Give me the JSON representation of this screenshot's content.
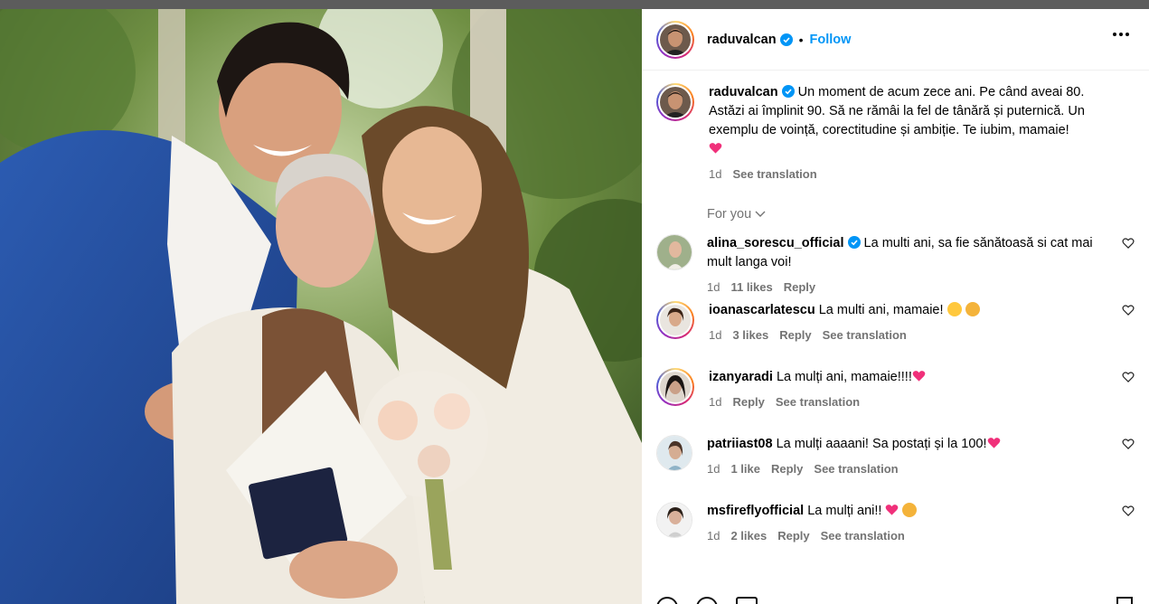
{
  "post": {
    "username": "raduvalcan",
    "follow_label": "Follow",
    "dot": "•",
    "caption": "Un moment de acum zece ani. Pe când aveai 80. Astăzi ai împlinit 90. Să ne rămâi la fel de tânără și puternică. Un exemplu de voință, corectitudine și ambiție. Te iubim, mamaie!",
    "caption_time": "1d",
    "see_translation": "See translation"
  },
  "for_you_label": "For you",
  "comments": [
    {
      "username": "alina_sorescu_official",
      "verified": true,
      "text": "La multi ani, sa fie sănătoasă si cat mai mult langa voi!",
      "time": "1d",
      "likes": "11 likes",
      "reply": "Reply",
      "translate": ""
    },
    {
      "username": "ioanascarlatescu",
      "verified": false,
      "text": "La multi ani, mamaie!",
      "time": "1d",
      "likes": "3 likes",
      "reply": "Reply",
      "translate": "See translation"
    },
    {
      "username": "izanyaradi",
      "verified": false,
      "text": "La mulți ani, mamaie!!!!",
      "time": "1d",
      "likes": "",
      "reply": "Reply",
      "translate": "See translation"
    },
    {
      "username": "patriiast08",
      "verified": false,
      "text": "La mulți aaaani! Sa postați și la 100!",
      "time": "1d",
      "likes": "1 like",
      "reply": "Reply",
      "translate": "See translation"
    },
    {
      "username": "msfireflyofficial",
      "verified": false,
      "text": "La mulți ani!!",
      "time": "1d",
      "likes": "2 likes",
      "reply": "Reply",
      "translate": "See translation"
    }
  ],
  "icons": {
    "verified": "verified-badge-icon",
    "heart": "heart-outline-icon",
    "more": "more-options-icon",
    "chevron": "chevron-down-icon"
  },
  "colors": {
    "link": "#0095f6",
    "muted": "#737373",
    "verified": "#0095f6",
    "emoji_heart": "#f0307a"
  }
}
